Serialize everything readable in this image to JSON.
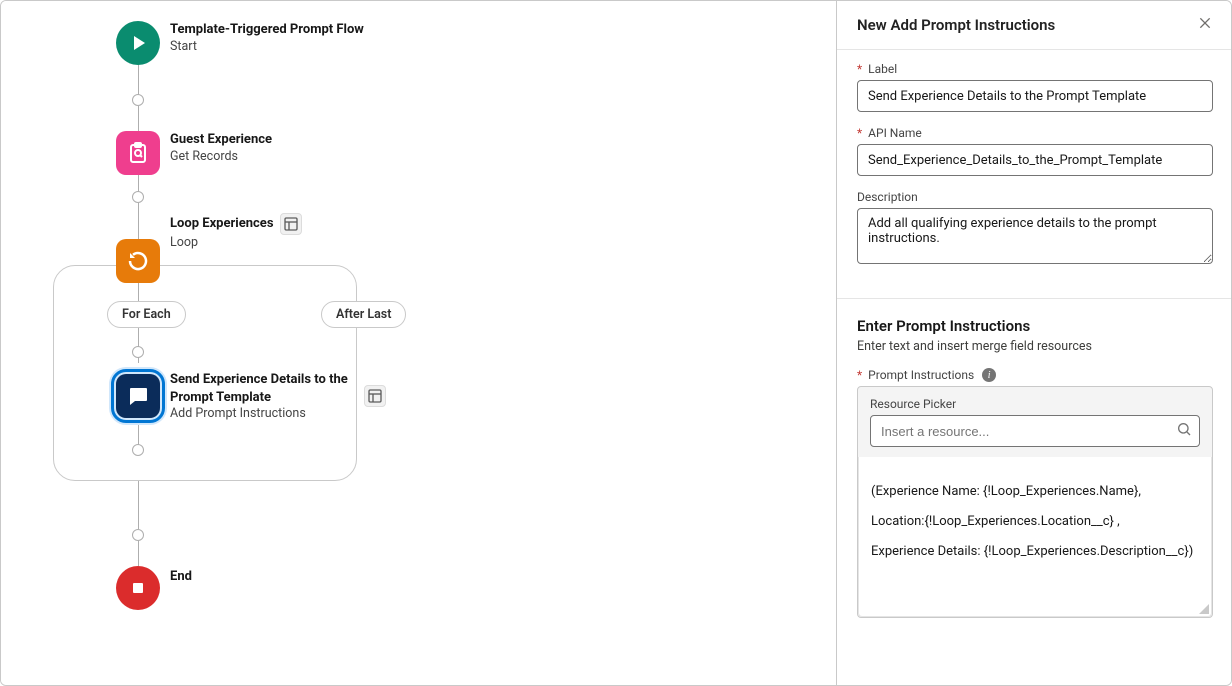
{
  "canvas": {
    "start": {
      "title": "Template-Triggered Prompt Flow",
      "sub": "Start"
    },
    "getrec": {
      "title": "Guest Experience",
      "sub": "Get Records"
    },
    "loop": {
      "title": "Loop Experiences",
      "sub": "Loop"
    },
    "forEach": "For Each",
    "afterLast": "After Last",
    "prompt": {
      "title": "Send Experience Details to the Prompt Template",
      "sub": "Add Prompt Instructions"
    },
    "end": "End"
  },
  "panel": {
    "title": "New Add Prompt Instructions",
    "labelField": "Label",
    "labelValue": "Send Experience Details to the Prompt Template",
    "apiField": "API Name",
    "apiValue": "Send_Experience_Details_to_the_Prompt_Template",
    "descField": "Description",
    "descValue": "Add all qualifying experience details to the prompt instructions.",
    "section2Title": "Enter Prompt Instructions",
    "section2Hint": "Enter text and insert merge field resources",
    "promptField": "Prompt Instructions",
    "resourceLabel": "Resource Picker",
    "resourcePlaceholder": "Insert a resource...",
    "promptLine1": "(Experience Name: {!Loop_Experiences.Name},",
    "promptLine2": " Location:{!Loop_Experiences.Location__c} ,",
    "promptLine3": " Experience Details: {!Loop_Experiences.Description__c})"
  }
}
